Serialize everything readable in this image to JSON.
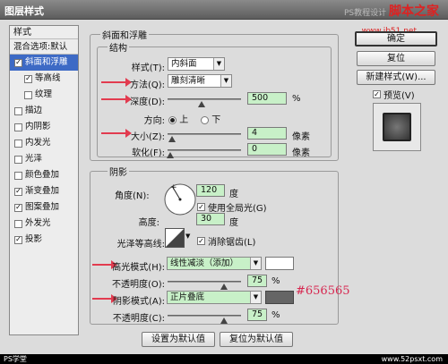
{
  "window": {
    "title": "图层样式"
  },
  "watermark": {
    "text": "PS教程设计",
    "brand": "脚本之家",
    "url": "www.jb51.net"
  },
  "left_panel": {
    "header": "样式",
    "blending": "混合选项:默认",
    "items": [
      {
        "label": "斜面和浮雕",
        "checked": true,
        "selected": true
      },
      {
        "label": "等高线",
        "checked": true,
        "sub": true
      },
      {
        "label": "纹理",
        "checked": false,
        "sub": true
      },
      {
        "label": "描边",
        "checked": false
      },
      {
        "label": "内阴影",
        "checked": false
      },
      {
        "label": "内发光",
        "checked": false
      },
      {
        "label": "光泽",
        "checked": false
      },
      {
        "label": "颜色叠加",
        "checked": false
      },
      {
        "label": "渐变叠加",
        "checked": true
      },
      {
        "label": "图案叠加",
        "checked": true
      },
      {
        "label": "外发光",
        "checked": false
      },
      {
        "label": "投影",
        "checked": true
      }
    ]
  },
  "bevel": {
    "title": "斜面和浮雕",
    "structure": "结构",
    "style_label": "样式(T):",
    "style_value": "内斜面",
    "technique_label": "方法(Q):",
    "technique_value": "雕刻清晰",
    "depth_label": "深度(D):",
    "depth_value": "500",
    "percent": "%",
    "direction_label": "方向:",
    "dir_up": "上",
    "dir_down": "下",
    "size_label": "大小(Z):",
    "size_value": "4",
    "px": "像素",
    "soften_label": "软化(F):",
    "soften_value": "0"
  },
  "shading": {
    "title": "阴影",
    "angle_label": "角度(N):",
    "angle_value": "120",
    "degree": "度",
    "global_light": "使用全局光(G)",
    "altitude_label": "高度:",
    "altitude_value": "30",
    "contour_label": "光泽等高线:",
    "antialias": "消除锯齿(L)",
    "highlight_label": "高光模式(H):",
    "highlight_value": "线性减淡（添加）",
    "highlight_opacity_label": "不透明度(O):",
    "highlight_opacity": "75",
    "shadow_label": "阴影模式(A):",
    "shadow_value": "正片叠底",
    "shadow_color_hex": "#656565",
    "shadow_opacity_label": "不透明度(C):",
    "shadow_opacity": "75"
  },
  "buttons": {
    "ok": "确定",
    "reset": "复位",
    "new_style": "新建样式(W)...",
    "preview": "预览(V)",
    "set_default": "设置为默认值",
    "reset_default": "复位为默认值"
  },
  "footer": {
    "left": "PS学堂",
    "right": "www.52psxt.com"
  }
}
